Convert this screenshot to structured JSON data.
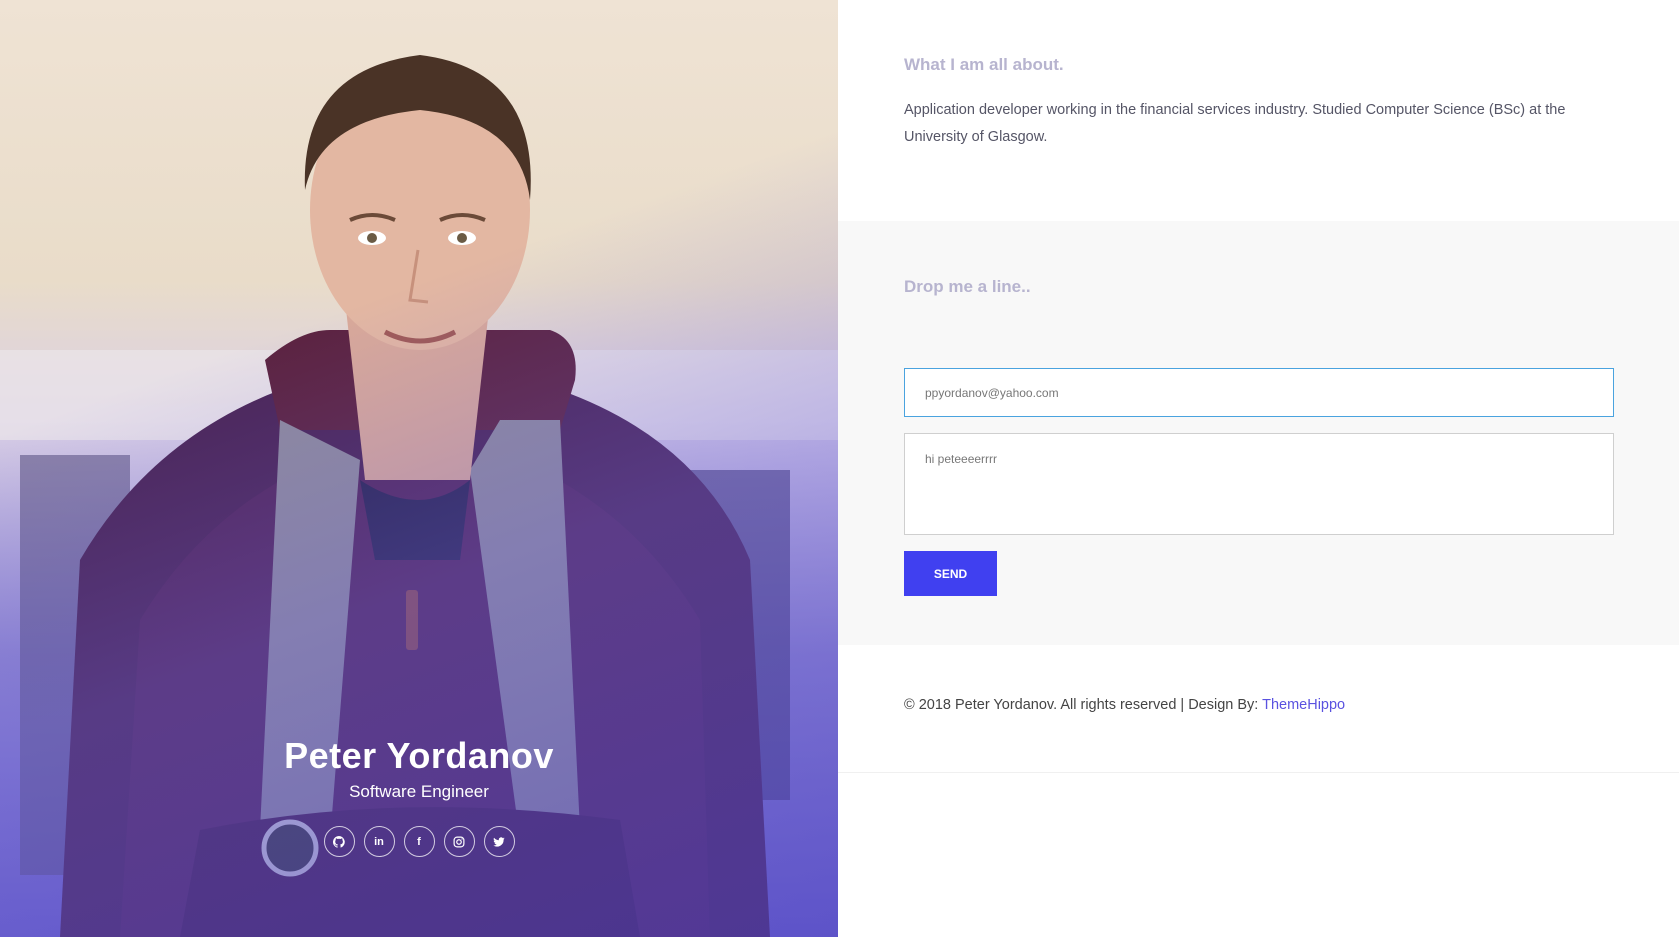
{
  "hero": {
    "name": "Peter Yordanov",
    "title": "Software Engineer",
    "socials": [
      {
        "icon": "github-icon"
      },
      {
        "icon": "linkedin-icon",
        "glyph": "in"
      },
      {
        "icon": "facebook-icon",
        "glyph": "f"
      },
      {
        "icon": "instagram-icon"
      },
      {
        "icon": "twitter-icon"
      }
    ]
  },
  "about": {
    "heading": "What I am all about.",
    "text": "Application developer working in the financial services industry. Studied Computer Science (BSc) at the University of Glasgow."
  },
  "contact": {
    "heading": "Drop me a line..",
    "email_value": "ppyordanov@yahoo.com",
    "message_value": "hi peteeeerrrr",
    "send_label": "SEND"
  },
  "footer": {
    "text": "© 2018 Peter Yordanov. All rights reserved | Design By: ",
    "link_label": "ThemeHippo"
  },
  "colors": {
    "accent": "#4040f0",
    "heading": "#b7b4cf",
    "link": "#5a52e0",
    "input_focus_border": "#4aa3df"
  }
}
